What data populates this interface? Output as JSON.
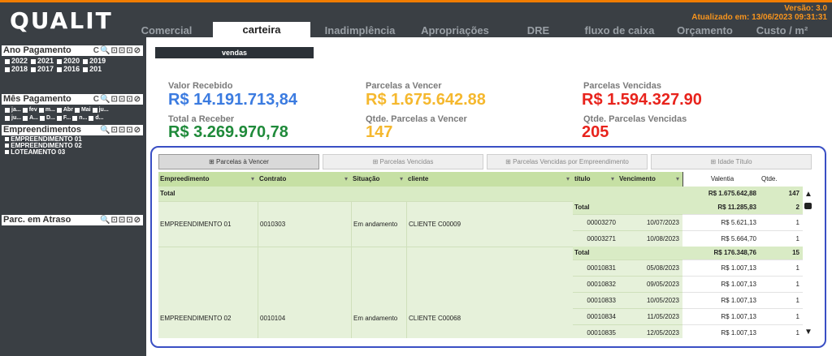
{
  "app": {
    "logo": "QUALIT",
    "version": "Versão: 3.0",
    "updated": "Atualizado em: 13/06/2023 09:31:31"
  },
  "nav": {
    "tabs": [
      "Comercial",
      "carteira",
      "Inadimplência",
      "Apropriações",
      "DRE",
      "fluxo de caixa",
      "Orçamento",
      "Custo / m²"
    ]
  },
  "sidebar": {
    "ano": {
      "title": "Ano Pagamento",
      "row1": [
        "2022",
        "2021",
        "2020",
        "2019"
      ],
      "row2": [
        "2018",
        "2017",
        "2016",
        "201"
      ]
    },
    "mes": {
      "title": "Mês Pagamento",
      "row1": [
        "ja...",
        "fev",
        "m...",
        "Abr",
        "Mai",
        "ju..."
      ],
      "row2": [
        "ju...",
        "A...",
        "D...",
        "F...",
        "n...",
        "d..."
      ]
    },
    "emp": {
      "title": "Empreendimentos",
      "items": [
        "EMPREENDIMENTO 01",
        "EMPREENDIMENTO 02",
        "LOTEAMENTO 03"
      ]
    },
    "parc": {
      "title": "Parc. em Atraso"
    },
    "tools": "C🔍⊡⊡⊡⊘",
    "tools2": "🔍⊡⊡⊡⊘"
  },
  "main": {
    "sheet_tab": "vendas",
    "kpis": [
      {
        "label": "Valor Recebido",
        "value": "R$ 14.191.713,84",
        "color": "#3b7be0"
      },
      {
        "label": "Parcelas a Vencer",
        "value": "R$ 1.675.642.88",
        "color": "#f5b82e"
      },
      {
        "label": "Parcelas Vencidas",
        "value": "R$ 1.594.327.90",
        "color": "#e8231c"
      },
      {
        "label": "Total a Receber",
        "value": "R$ 3.269.970,78",
        "color": "#1f8a3a"
      },
      {
        "label": "Qtde. Parcelas a Vencer",
        "value": "147",
        "color": "#f5b82e"
      },
      {
        "label": "Qtde. Parcelas Vencidas",
        "value": "205",
        "color": "#e8231c"
      }
    ],
    "subtabs": [
      "Parcelas à Vencer",
      "Parcelas Vencidas",
      "Parcelas Vencidas por Empreendimento",
      "Idade Título"
    ],
    "table": {
      "headers": [
        "Empreedimento",
        "Contrato",
        "Situação",
        "cliente",
        "título",
        "Vencimento",
        "Valentia",
        "Qtde."
      ],
      "total_label": "Total",
      "total_value": "R$ 1.675.642,88",
      "total_qty": "147",
      "groups": [
        {
          "emp": "EMPREENDIMENTO 01",
          "contrato": "0010303",
          "situacao": "Em andamento",
          "cliente": "CLIENTE C00009",
          "subtotal_label": "Total",
          "subtotal_value": "R$ 11.285,83",
          "subtotal_qty": "2",
          "rows": [
            {
              "titulo": "00003270",
              "venc": "10/07/2023",
              "valor": "R$ 5.621,13",
              "qtd": "1"
            },
            {
              "titulo": "00003271",
              "venc": "10/08/2023",
              "valor": "R$ 5.664,70",
              "qtd": "1"
            }
          ]
        },
        {
          "emp": "EMPREENDIMENTO 02",
          "contrato": "0010104",
          "situacao": "Em andamento",
          "cliente": "CLIENTE C00068",
          "subtotal_label": "Total",
          "subtotal_value": "R$ 176.348,76",
          "subtotal_qty": "15",
          "rows": [
            {
              "titulo": "00010831",
              "venc": "05/08/2023",
              "valor": "R$ 1.007,13",
              "qtd": "1"
            },
            {
              "titulo": "00010832",
              "venc": "09/05/2023",
              "valor": "R$ 1.007,13",
              "qtd": "1"
            },
            {
              "titulo": "00010833",
              "venc": "10/05/2023",
              "valor": "R$ 1.007,13",
              "qtd": "1"
            },
            {
              "titulo": "00010834",
              "venc": "11/05/2023",
              "valor": "R$ 1.007,13",
              "qtd": "1"
            },
            {
              "titulo": "00010835",
              "venc": "12/05/2023",
              "valor": "R$ 1.007,13",
              "qtd": "1"
            }
          ]
        }
      ]
    }
  }
}
